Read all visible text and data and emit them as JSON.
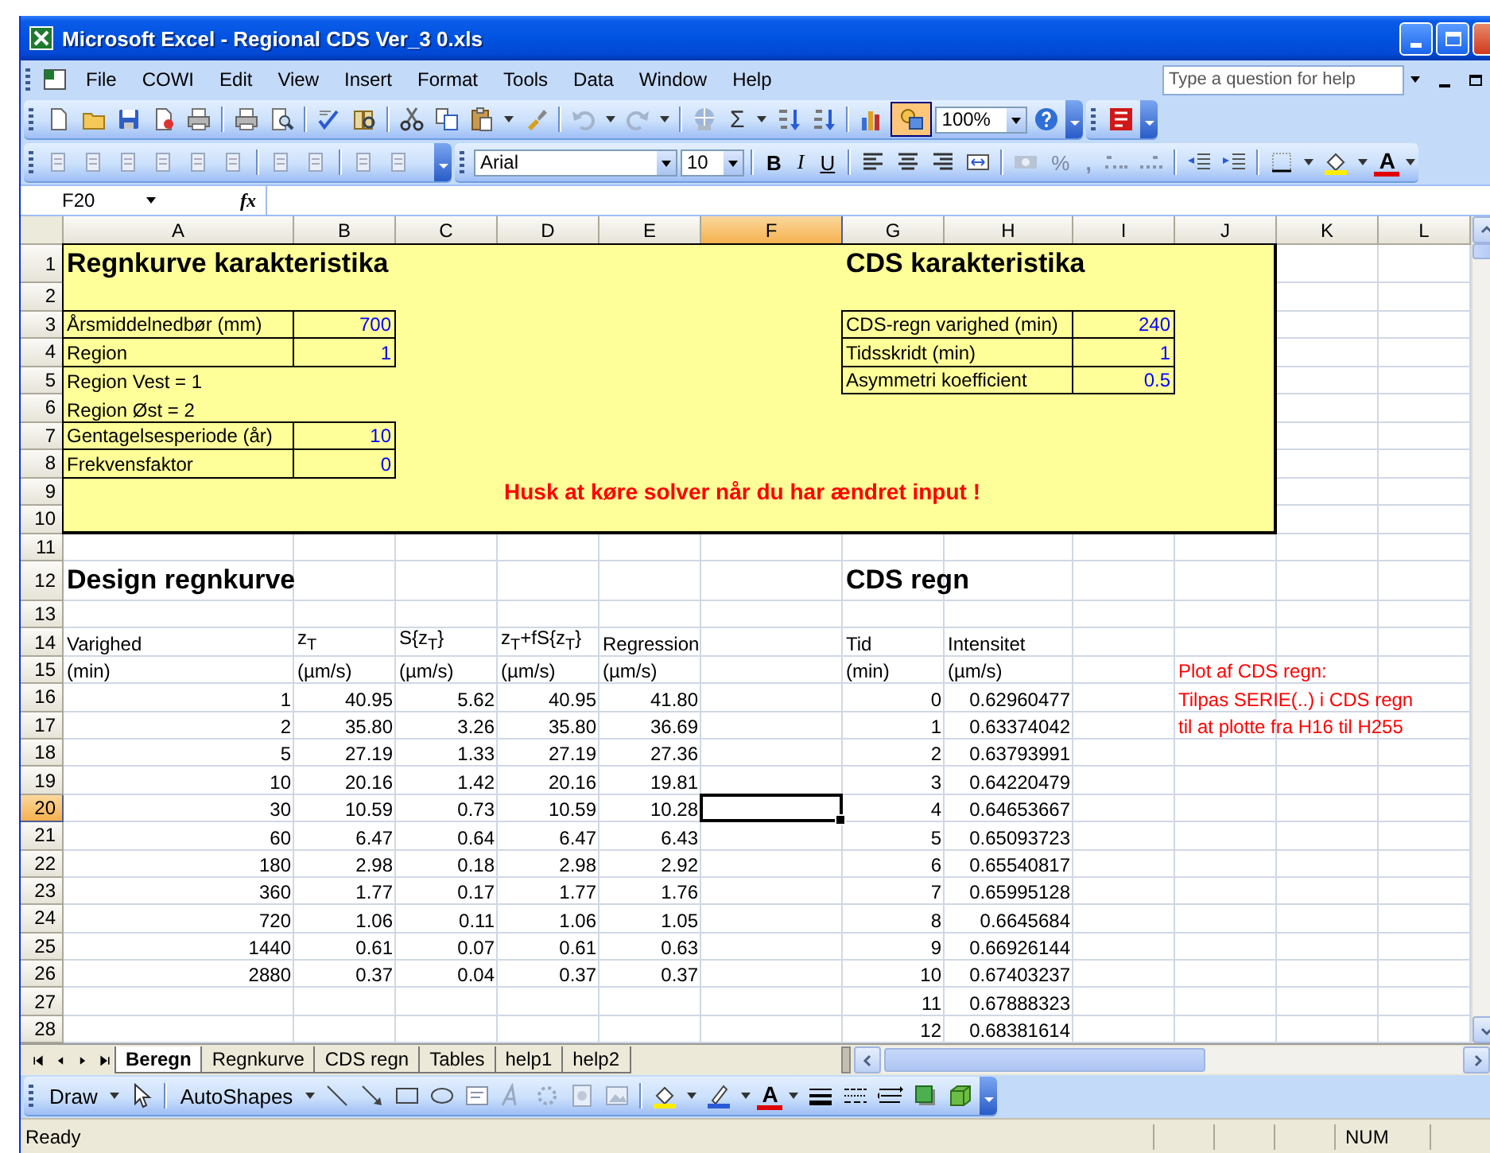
{
  "window": {
    "title": "Microsoft Excel - Regional CDS Ver_3 0.xls"
  },
  "menu": [
    "File",
    "COWI",
    "Edit",
    "View",
    "Insert",
    "Format",
    "Tools",
    "Data",
    "Window",
    "Help"
  ],
  "help_box": {
    "placeholder": "Type a question for help"
  },
  "standard_toolbar": {
    "sum": "Σ",
    "zoom": "100%",
    "drawing_button": {
      "pressed": true
    }
  },
  "formatting_toolbar": {
    "font": "Arial",
    "size": "10",
    "bold": "B",
    "italic": "I",
    "underline": "U",
    "percent": "%",
    "comma": ",",
    "font_color": "A"
  },
  "formula_bar": {
    "name_box": "F20",
    "fx": "fx"
  },
  "columns": [
    {
      "label": "A",
      "selected": false
    },
    {
      "label": "B",
      "selected": false
    },
    {
      "label": "C",
      "selected": false
    },
    {
      "label": "D",
      "selected": false
    },
    {
      "label": "E",
      "selected": false
    },
    {
      "label": "F",
      "selected": true
    },
    {
      "label": "G",
      "selected": false
    },
    {
      "label": "H",
      "selected": false
    },
    {
      "label": "I",
      "selected": false
    },
    {
      "label": "J",
      "selected": false
    },
    {
      "label": "K",
      "selected": false
    },
    {
      "label": "L",
      "selected": false
    }
  ],
  "rows": [
    {
      "label": "1",
      "selected": false
    },
    {
      "label": "2",
      "selected": false
    },
    {
      "label": "3",
      "selected": false
    },
    {
      "label": "4",
      "selected": false
    },
    {
      "label": "5",
      "selected": false
    },
    {
      "label": "6",
      "selected": false
    },
    {
      "label": "7",
      "selected": false
    },
    {
      "label": "8",
      "selected": false
    },
    {
      "label": "9",
      "selected": false
    },
    {
      "label": "10",
      "selected": false
    },
    {
      "label": "11",
      "selected": false
    },
    {
      "label": "12",
      "selected": false
    },
    {
      "label": "13",
      "selected": false
    },
    {
      "label": "14",
      "selected": false
    },
    {
      "label": "15",
      "selected": false
    },
    {
      "label": "16",
      "selected": false
    },
    {
      "label": "17",
      "selected": false
    },
    {
      "label": "18",
      "selected": false
    },
    {
      "label": "19",
      "selected": false
    },
    {
      "label": "20",
      "selected": true
    },
    {
      "label": "21",
      "selected": false
    },
    {
      "label": "22",
      "selected": false
    },
    {
      "label": "23",
      "selected": false
    },
    {
      "label": "24",
      "selected": false
    },
    {
      "label": "25",
      "selected": false
    },
    {
      "label": "26",
      "selected": false
    },
    {
      "label": "27",
      "selected": false
    },
    {
      "label": "28",
      "selected": false
    }
  ],
  "rain_curve_box": {
    "title": "Regnkurve karakteristika",
    "fields": [
      {
        "kind": "input",
        "label": "Årsmiddelnedbør (mm)",
        "value": "700"
      },
      {
        "kind": "input",
        "label": "Region",
        "value": "1"
      },
      {
        "kind": "note",
        "text": "Region Vest = 1"
      },
      {
        "kind": "note",
        "text": "Region Øst = 2"
      },
      {
        "kind": "input",
        "label": "Gentagelsesperiode (år)",
        "value": "10"
      },
      {
        "kind": "input",
        "label": "Frekvensfaktor",
        "value": "0"
      }
    ],
    "warning": "Husk at køre solver når du har ændret input !"
  },
  "cds_box": {
    "title": "CDS karakteristika",
    "fields": [
      {
        "kind": "input",
        "label": "CDS-regn varighed (min)",
        "value": "240"
      },
      {
        "kind": "input",
        "label": "Tidsskridt (min)",
        "value": "1"
      },
      {
        "kind": "input",
        "label": "Asymmetri koefficient",
        "value": "0.5"
      }
    ]
  },
  "design_curve": {
    "title": "Design regnkurve",
    "headers": [
      "Varighed",
      "z$_{T}$",
      "S{z$_{T}$}",
      "z$_{T}$+fS{z$_{T}$}",
      "Regression"
    ],
    "units": [
      "(min)",
      "(µm/s)",
      "(µm/s)",
      "(µm/s)",
      "(µm/s)"
    ],
    "rows": [
      [
        "1",
        "40.95",
        "5.62",
        "40.95",
        "41.80"
      ],
      [
        "2",
        "35.80",
        "3.26",
        "35.80",
        "36.69"
      ],
      [
        "5",
        "27.19",
        "1.33",
        "27.19",
        "27.36"
      ],
      [
        "10",
        "20.16",
        "1.42",
        "20.16",
        "19.81"
      ],
      [
        "30",
        "10.59",
        "0.73",
        "10.59",
        "10.28"
      ],
      [
        "60",
        "6.47",
        "0.64",
        "6.47",
        "6.43"
      ],
      [
        "180",
        "2.98",
        "0.18",
        "2.98",
        "2.92"
      ],
      [
        "360",
        "1.77",
        "0.17",
        "1.77",
        "1.76"
      ],
      [
        "720",
        "1.06",
        "0.11",
        "1.06",
        "1.05"
      ],
      [
        "1440",
        "0.61",
        "0.07",
        "0.61",
        "0.63"
      ],
      [
        "2880",
        "0.37",
        "0.04",
        "0.37",
        "0.37"
      ]
    ]
  },
  "cds_rain": {
    "title": "CDS regn",
    "headers": [
      "Tid",
      "Intensitet"
    ],
    "units": [
      "(min)",
      "(µm/s)"
    ],
    "rows": [
      [
        "0",
        "0.62960477"
      ],
      [
        "1",
        "0.63374042"
      ],
      [
        "2",
        "0.63793991"
      ],
      [
        "3",
        "0.64220479"
      ],
      [
        "4",
        "0.64653667"
      ],
      [
        "5",
        "0.65093723"
      ],
      [
        "6",
        "0.65540817"
      ],
      [
        "7",
        "0.65995128"
      ],
      [
        "8",
        "0.6645684"
      ],
      [
        "9",
        "0.66926144"
      ],
      [
        "10",
        "0.67403237"
      ],
      [
        "11",
        "0.67888323"
      ],
      [
        "12",
        "0.68381614"
      ]
    ]
  },
  "plot_note": [
    "Plot af CDS regn:",
    "Tilpas SERIE(..) i CDS regn",
    "til at plotte fra H16 til H255"
  ],
  "sheet_tabs": [
    {
      "label": "Beregn",
      "selected": true
    },
    {
      "label": "Regnkurve",
      "selected": false
    },
    {
      "label": "CDS regn",
      "selected": false
    },
    {
      "label": "Tables",
      "selected": false
    },
    {
      "label": "help1",
      "selected": false
    },
    {
      "label": "help2",
      "selected": false
    }
  ],
  "drawing_toolbar": {
    "draw": "Draw",
    "autoshapes": "AutoShapes",
    "font_color": "A"
  },
  "status_bar": {
    "status": "Ready",
    "indicator": "NUM"
  }
}
